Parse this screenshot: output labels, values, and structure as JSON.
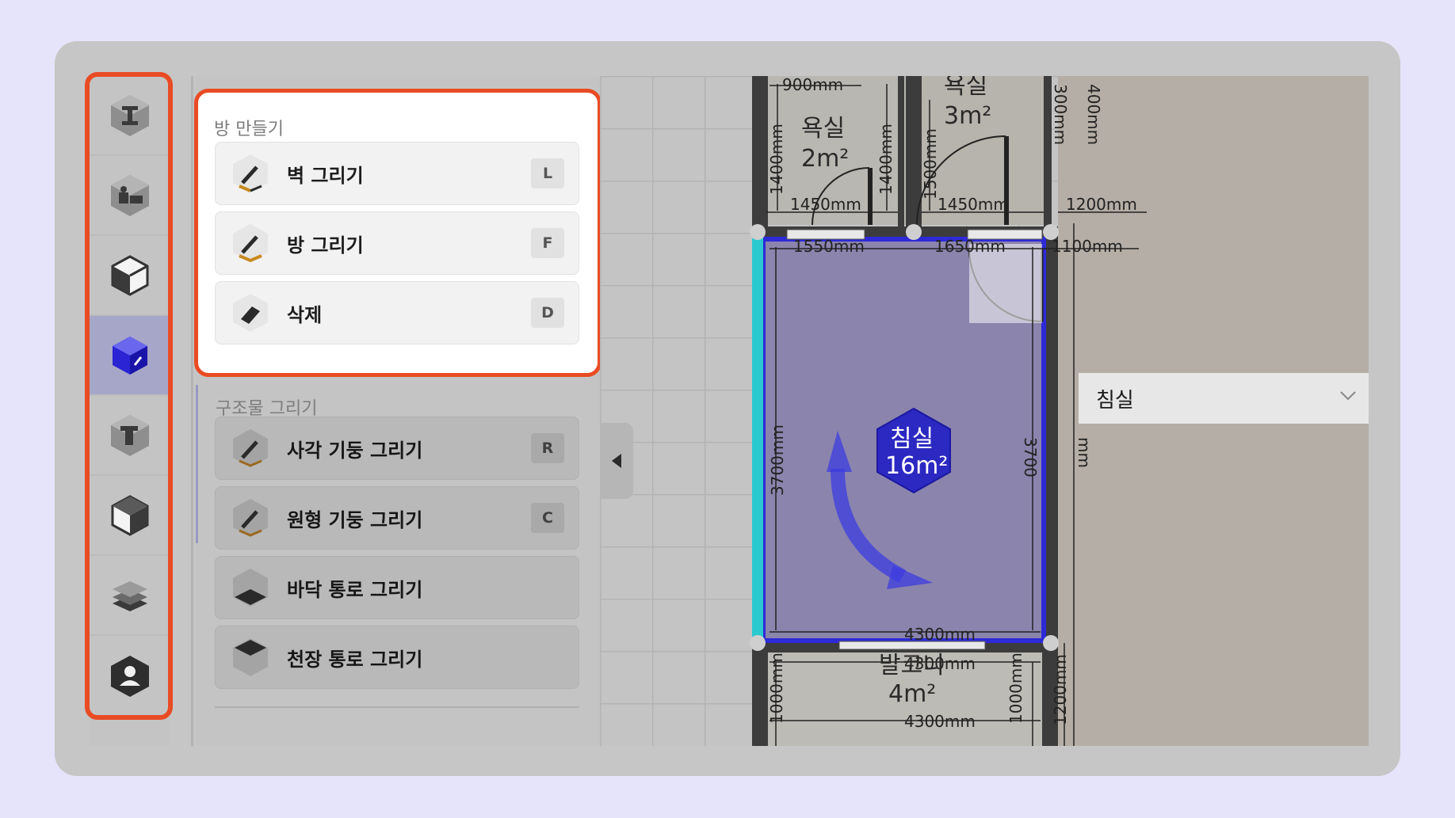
{
  "sidebar": {
    "items": [
      {
        "icon": "beam-icon",
        "active": false
      },
      {
        "icon": "furniture-icon",
        "active": false
      },
      {
        "icon": "stairs-box-icon",
        "active": false
      },
      {
        "icon": "room-draw-icon",
        "active": true
      },
      {
        "icon": "column-icon",
        "active": false
      },
      {
        "icon": "step-box-icon",
        "active": false
      },
      {
        "icon": "layers-icon",
        "active": false
      },
      {
        "icon": "user-icon",
        "active": false
      }
    ]
  },
  "panel": {
    "room_section": {
      "title": "방 만들기",
      "tools": [
        {
          "label": "벽 그리기",
          "key": "L",
          "icon": "wall-pencil-icon"
        },
        {
          "label": "방 그리기",
          "key": "F",
          "icon": "room-pencil-icon"
        },
        {
          "label": "삭제",
          "key": "D",
          "icon": "eraser-icon"
        }
      ]
    },
    "structure_section": {
      "title": "구조물 그리기",
      "tools": [
        {
          "label": "사각 기둥 그리기",
          "key": "R",
          "icon": "square-column-icon"
        },
        {
          "label": "원형 기둥 그리기",
          "key": "C",
          "icon": "round-column-icon"
        },
        {
          "label": "바닥 통로 그리기",
          "key": "",
          "icon": "floor-opening-icon"
        },
        {
          "label": "천장 통로 그리기",
          "key": "",
          "icon": "ceiling-opening-icon"
        }
      ]
    }
  },
  "floorplan": {
    "rooms": {
      "bath1": {
        "name": "욕실",
        "area": "2m²"
      },
      "bath2": {
        "name": "욕실",
        "area": "3m²"
      },
      "bedroom": {
        "name": "침실",
        "area": "16m²"
      },
      "balcony": {
        "name": "발코니",
        "area": "4m²"
      }
    },
    "dimensions": {
      "d900": "900mm",
      "d1400a": "1400mm",
      "d1400b": "1400mm",
      "d1500": "1500mm",
      "d300": "300mm",
      "d400": "400mm",
      "d1450a": "1450mm",
      "d1450b": "1450mm",
      "d1200top": "1200mm",
      "d1550": "1550mm",
      "d1650": "1650mm",
      "d1100": "1100mm",
      "d3700l": "3700mm",
      "d3700r": "3700",
      "dmm": "mm",
      "d4300a": "4300mm",
      "d4300b": "4300mm",
      "d4300c": "4300mm",
      "d1000l": "1000mm",
      "d1000r": "1000mm",
      "d1200r": "1200mm"
    }
  },
  "room_type_select": {
    "value": "침실"
  },
  "colors": {
    "highlight": "#e94b24",
    "selection": "#3b3bd0",
    "wall_edge": "#29c9cf",
    "room_fill": "#8b84ad"
  }
}
